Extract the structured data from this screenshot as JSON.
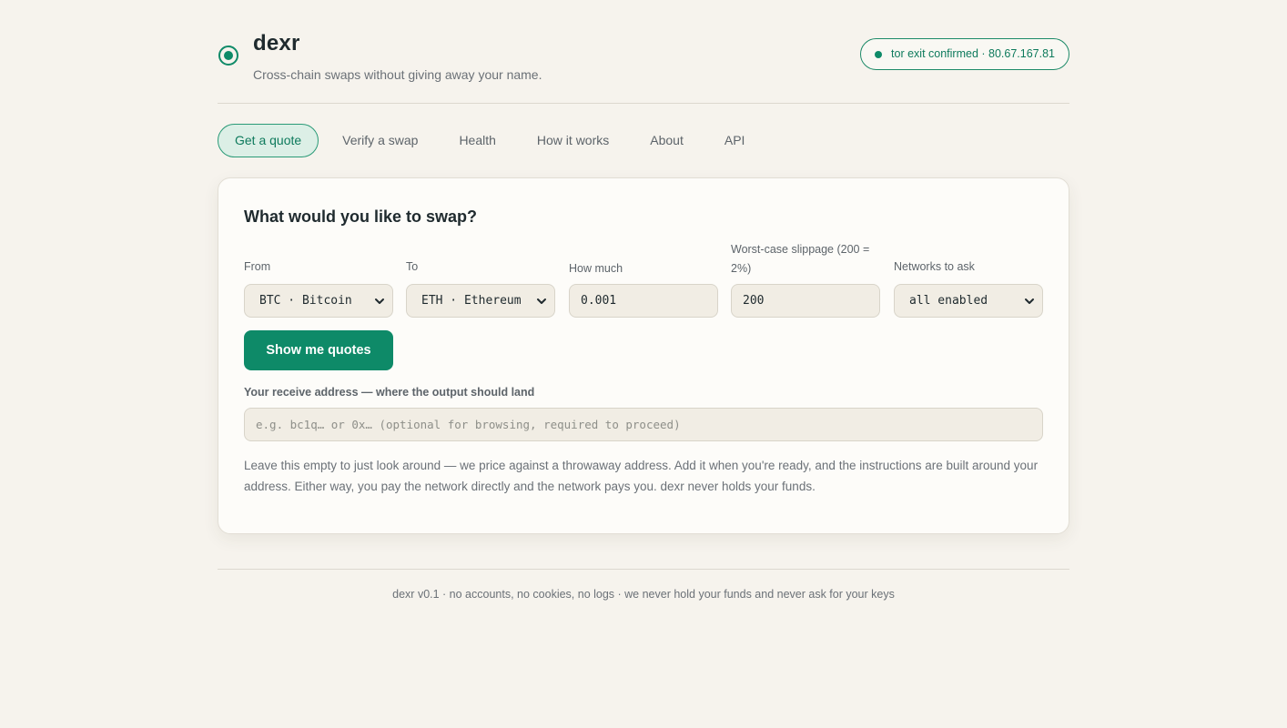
{
  "header": {
    "brand": "dexr",
    "tagline": "Cross-chain swaps without giving away your name.",
    "logo_icon": "target-icon",
    "tor_badge": "tor exit confirmed · 80.67.167.81"
  },
  "nav": {
    "items": [
      {
        "label": "Get a quote",
        "active": true
      },
      {
        "label": "Verify a swap",
        "active": false
      },
      {
        "label": "Health",
        "active": false
      },
      {
        "label": "How it works",
        "active": false
      },
      {
        "label": "About",
        "active": false
      },
      {
        "label": "API",
        "active": false
      }
    ]
  },
  "swap_form": {
    "title": "What would you like to swap?",
    "from": {
      "label": "From",
      "value": "BTC · Bitcoin"
    },
    "to": {
      "label": "To",
      "value": "ETH · Ethereum"
    },
    "amount": {
      "label": "How much",
      "value": "0.001"
    },
    "slippage": {
      "label": "Worst-case slippage (200 = 2%)",
      "value": "200"
    },
    "networks": {
      "label": "Networks to ask",
      "value": "all enabled"
    },
    "submit_label": "Show me quotes",
    "receive_address": {
      "label": "Your receive address — where the output should land",
      "placeholder": "e.g. bc1q… or 0x… (optional for browsing, required to proceed)",
      "value": ""
    },
    "help_text": "Leave this empty to just look around — we price against a throwaway address. Add it when you're ready, and the instructions are built around your address. Either way, you pay the network directly and the network pays you. dexr never holds your funds."
  },
  "footer": {
    "text": "dexr v0.1 · no accounts, no cookies, no logs · we never hold your funds and never ask for your keys"
  },
  "colors": {
    "accent": "#0e8a68",
    "background": "#f6f3ed",
    "card": "#fdfcf9"
  }
}
